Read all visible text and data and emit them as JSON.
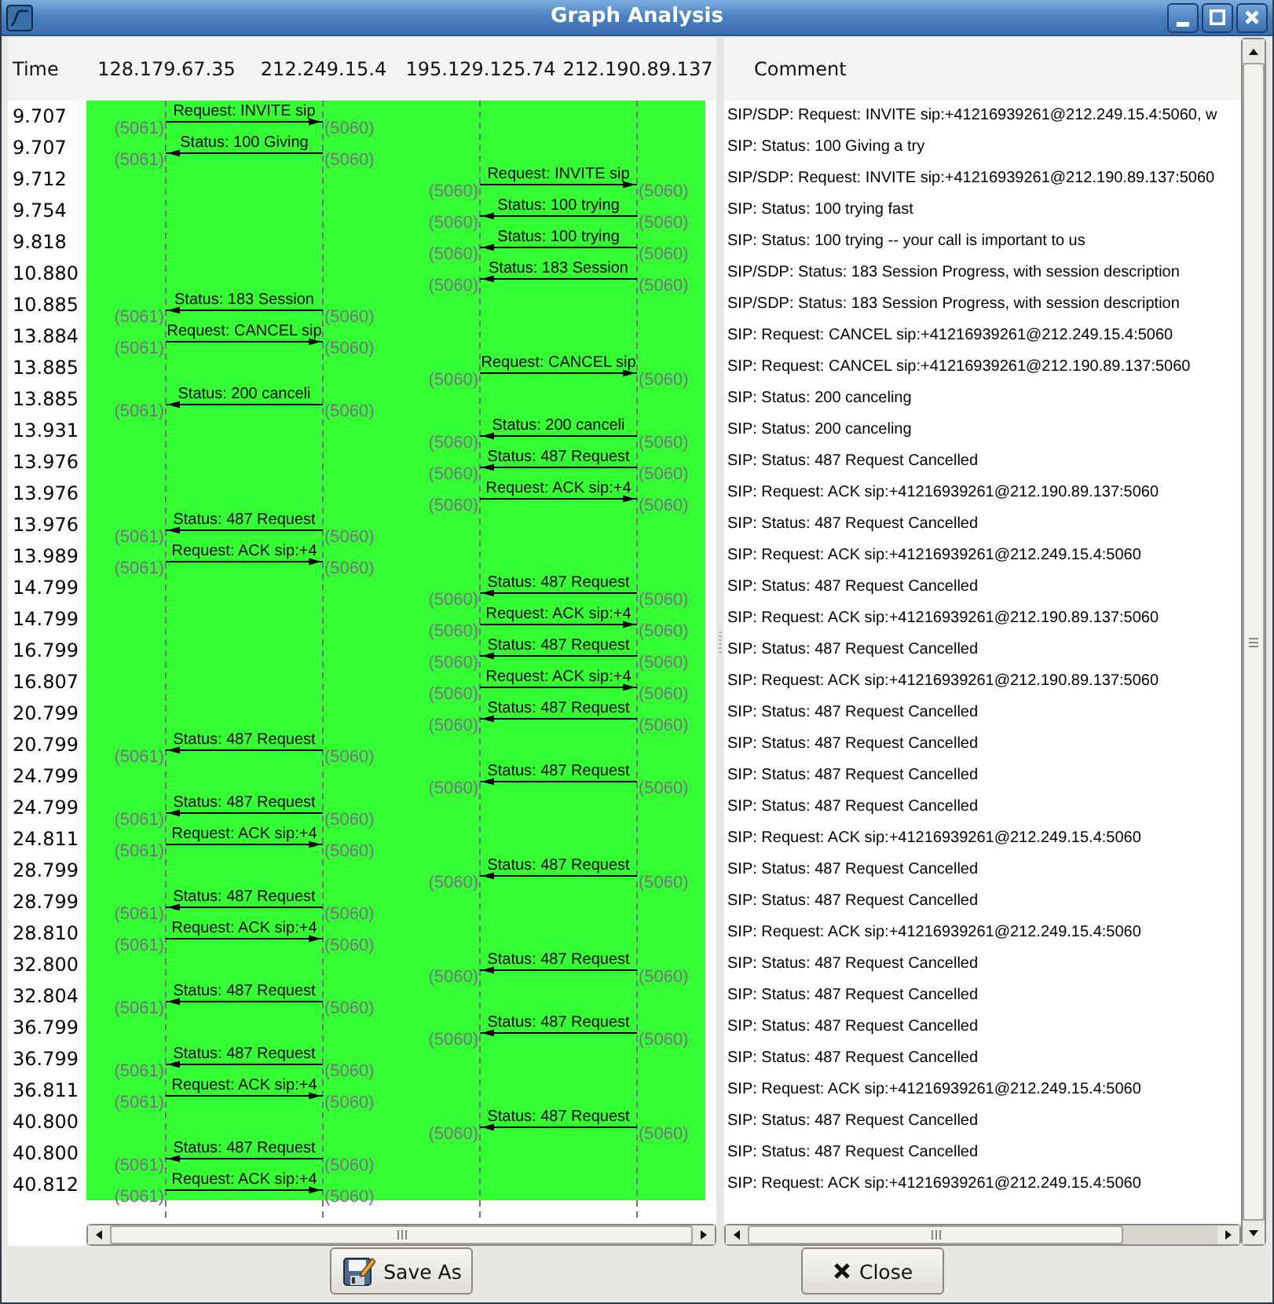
{
  "window": {
    "title": "Graph Analysis"
  },
  "graph": {
    "time_header": "Time",
    "hosts": [
      "128.179.67.35",
      "212.249.15.4",
      "195.129.125.74",
      "212.190.89.137"
    ],
    "comment_header": "Comment",
    "rows": [
      {
        "time": "9.707",
        "hosts_1_2": {
          "kind": "rightward",
          "label": "Request: INVITE sip",
          "left_port": "(5061)",
          "right_port": "(5060)"
        },
        "comment": "SIP/SDP: Request: INVITE sip:+41216939261@212.249.15.4:5060, w"
      },
      {
        "time": "9.707",
        "hosts_1_2": {
          "kind": "leftward",
          "label": "Status: 100 Giving",
          "left_port": "(5061)",
          "right_port": "(5060)"
        },
        "comment": "SIP: Status: 100 Giving a try"
      },
      {
        "time": "9.712",
        "hosts_3_4": {
          "kind": "rightward",
          "label": "Request: INVITE sip",
          "left_port": "(5060)",
          "right_port": "(5060)"
        },
        "comment": "SIP/SDP: Request: INVITE sip:+41216939261@212.190.89.137:5060"
      },
      {
        "time": "9.754",
        "hosts_3_4": {
          "kind": "leftward",
          "label": "Status: 100 trying",
          "left_port": "(5060)",
          "right_port": "(5060)"
        },
        "comment": "SIP: Status: 100 trying fast"
      },
      {
        "time": "9.818",
        "hosts_3_4": {
          "kind": "leftward",
          "label": "Status: 100 trying",
          "left_port": "(5060)",
          "right_port": "(5060)"
        },
        "comment": "SIP: Status: 100 trying -- your call is important to us"
      },
      {
        "time": "10.880",
        "hosts_3_4": {
          "kind": "leftward",
          "label": "Status: 183 Session",
          "left_port": "(5060)",
          "right_port": "(5060)"
        },
        "comment": "SIP/SDP: Status: 183 Session Progress, with session description"
      },
      {
        "time": "10.885",
        "hosts_1_2": {
          "kind": "leftward",
          "label": "Status: 183 Session",
          "left_port": "(5061)",
          "right_port": "(5060)"
        },
        "comment": "SIP/SDP: Status: 183 Session Progress, with session description"
      },
      {
        "time": "13.884",
        "hosts_1_2": {
          "kind": "rightward",
          "label": "Request: CANCEL sip",
          "left_port": "(5061)",
          "right_port": "(5060)"
        },
        "comment": "SIP: Request: CANCEL sip:+41216939261@212.249.15.4:5060"
      },
      {
        "time": "13.885",
        "hosts_3_4": {
          "kind": "rightward",
          "label": "Request: CANCEL sip",
          "left_port": "(5060)",
          "right_port": "(5060)"
        },
        "comment": "SIP: Request: CANCEL sip:+41216939261@212.190.89.137:5060"
      },
      {
        "time": "13.885",
        "hosts_1_2": {
          "kind": "leftward",
          "label": "Status: 200 canceli",
          "left_port": "(5061)",
          "right_port": "(5060)"
        },
        "comment": "SIP: Status: 200 canceling"
      },
      {
        "time": "13.931",
        "hosts_3_4": {
          "kind": "leftward",
          "label": "Status: 200 canceli",
          "left_port": "(5060)",
          "right_port": "(5060)"
        },
        "comment": "SIP: Status: 200 canceling"
      },
      {
        "time": "13.976",
        "hosts_3_4": {
          "kind": "leftward",
          "label": "Status: 487 Request",
          "left_port": "(5060)",
          "right_port": "(5060)"
        },
        "comment": "SIP: Status: 487 Request Cancelled"
      },
      {
        "time": "13.976",
        "hosts_3_4": {
          "kind": "rightward",
          "label": "Request: ACK sip:+4",
          "left_port": "(5060)",
          "right_port": "(5060)"
        },
        "comment": "SIP: Request: ACK sip:+41216939261@212.190.89.137:5060"
      },
      {
        "time": "13.976",
        "hosts_1_2": {
          "kind": "leftward",
          "label": "Status: 487 Request",
          "left_port": "(5061)",
          "right_port": "(5060)"
        },
        "comment": "SIP: Status: 487 Request Cancelled"
      },
      {
        "time": "13.989",
        "hosts_1_2": {
          "kind": "rightward",
          "label": "Request: ACK sip:+4",
          "left_port": "(5061)",
          "right_port": "(5060)"
        },
        "comment": "SIP: Request: ACK sip:+41216939261@212.249.15.4:5060"
      },
      {
        "time": "14.799",
        "hosts_3_4": {
          "kind": "leftward",
          "label": "Status: 487 Request",
          "left_port": "(5060)",
          "right_port": "(5060)"
        },
        "comment": "SIP: Status: 487 Request Cancelled"
      },
      {
        "time": "14.799",
        "hosts_3_4": {
          "kind": "rightward",
          "label": "Request: ACK sip:+4",
          "left_port": "(5060)",
          "right_port": "(5060)"
        },
        "comment": "SIP: Request: ACK sip:+41216939261@212.190.89.137:5060"
      },
      {
        "time": "16.799",
        "hosts_3_4": {
          "kind": "leftward",
          "label": "Status: 487 Request",
          "left_port": "(5060)",
          "right_port": "(5060)"
        },
        "comment": "SIP: Status: 487 Request Cancelled"
      },
      {
        "time": "16.807",
        "hosts_3_4": {
          "kind": "rightward",
          "label": "Request: ACK sip:+4",
          "left_port": "(5060)",
          "right_port": "(5060)"
        },
        "comment": "SIP: Request: ACK sip:+41216939261@212.190.89.137:5060"
      },
      {
        "time": "20.799",
        "hosts_3_4": {
          "kind": "leftward",
          "label": "Status: 487 Request",
          "left_port": "(5060)",
          "right_port": "(5060)"
        },
        "comment": "SIP: Status: 487 Request Cancelled"
      },
      {
        "time": "20.799",
        "hosts_1_2": {
          "kind": "leftward",
          "label": "Status: 487 Request",
          "left_port": "(5061)",
          "right_port": "(5060)"
        },
        "comment": "SIP: Status: 487 Request Cancelled"
      },
      {
        "time": "24.799",
        "hosts_3_4": {
          "kind": "leftward",
          "label": "Status: 487 Request",
          "left_port": "(5060)",
          "right_port": "(5060)"
        },
        "comment": "SIP: Status: 487 Request Cancelled"
      },
      {
        "time": "24.799",
        "hosts_1_2": {
          "kind": "leftward",
          "label": "Status: 487 Request",
          "left_port": "(5061)",
          "right_port": "(5060)"
        },
        "comment": "SIP: Status: 487 Request Cancelled"
      },
      {
        "time": "24.811",
        "hosts_1_2": {
          "kind": "rightward",
          "label": "Request: ACK sip:+4",
          "left_port": "(5061)",
          "right_port": "(5060)"
        },
        "comment": "SIP: Request: ACK sip:+41216939261@212.249.15.4:5060"
      },
      {
        "time": "28.799",
        "hosts_3_4": {
          "kind": "leftward",
          "label": "Status: 487 Request",
          "left_port": "(5060)",
          "right_port": "(5060)"
        },
        "comment": "SIP: Status: 487 Request Cancelled"
      },
      {
        "time": "28.799",
        "hosts_1_2": {
          "kind": "leftward",
          "label": "Status: 487 Request",
          "left_port": "(5061)",
          "right_port": "(5060)"
        },
        "comment": "SIP: Status: 487 Request Cancelled"
      },
      {
        "time": "28.810",
        "hosts_1_2": {
          "kind": "rightward",
          "label": "Request: ACK sip:+4",
          "left_port": "(5061)",
          "right_port": "(5060)"
        },
        "comment": "SIP: Request: ACK sip:+41216939261@212.249.15.4:5060"
      },
      {
        "time": "32.800",
        "hosts_3_4": {
          "kind": "leftward",
          "label": "Status: 487 Request",
          "left_port": "(5060)",
          "right_port": "(5060)"
        },
        "comment": "SIP: Status: 487 Request Cancelled"
      },
      {
        "time": "32.804",
        "hosts_1_2": {
          "kind": "leftward",
          "label": "Status: 487 Request",
          "left_port": "(5061)",
          "right_port": "(5060)"
        },
        "comment": "SIP: Status: 487 Request Cancelled"
      },
      {
        "time": "36.799",
        "hosts_3_4": {
          "kind": "leftward",
          "label": "Status: 487 Request",
          "left_port": "(5060)",
          "right_port": "(5060)"
        },
        "comment": "SIP: Status: 487 Request Cancelled"
      },
      {
        "time": "36.799",
        "hosts_1_2": {
          "kind": "leftward",
          "label": "Status: 487 Request",
          "left_port": "(5061)",
          "right_port": "(5060)"
        },
        "comment": "SIP: Status: 487 Request Cancelled"
      },
      {
        "time": "36.811",
        "hosts_1_2": {
          "kind": "rightward",
          "label": "Request: ACK sip:+4",
          "left_port": "(5061)",
          "right_port": "(5060)"
        },
        "comment": "SIP: Request: ACK sip:+41216939261@212.249.15.4:5060"
      },
      {
        "time": "40.800",
        "hosts_3_4": {
          "kind": "leftward",
          "label": "Status: 487 Request",
          "left_port": "(5060)",
          "right_port": "(5060)"
        },
        "comment": "SIP: Status: 487 Request Cancelled"
      },
      {
        "time": "40.800",
        "hosts_1_2": {
          "kind": "leftward",
          "label": "Status: 487 Request",
          "left_port": "(5061)",
          "right_port": "(5060)"
        },
        "comment": "SIP: Status: 487 Request Cancelled"
      },
      {
        "time": "40.812",
        "hosts_1_2": {
          "kind": "rightward",
          "label": "Request: ACK sip:+4",
          "left_port": "(5061)",
          "right_port": "(5060)"
        },
        "comment": "SIP: Request: ACK sip:+41216939261@212.249.15.4:5060"
      }
    ]
  },
  "buttons": [
    {
      "kind": "save",
      "label": "Save As"
    },
    {
      "kind": "close",
      "label": "Close"
    }
  ]
}
